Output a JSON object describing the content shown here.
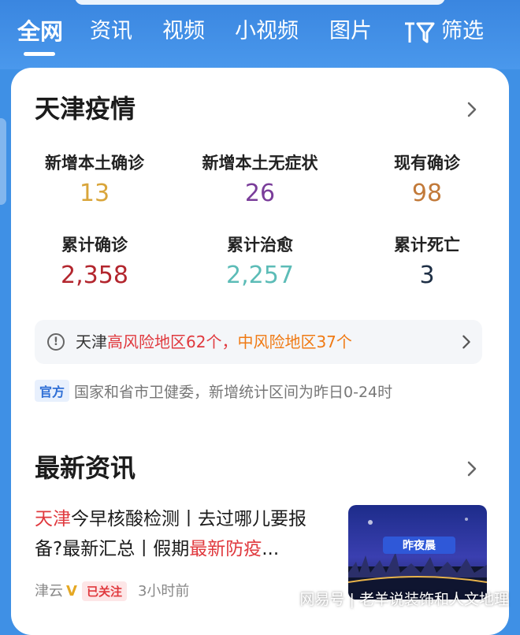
{
  "tabs": [
    "全网",
    "资讯",
    "视频",
    "小视频",
    "图片"
  ],
  "filter_label": "筛选",
  "epidemic": {
    "title": "天津疫情",
    "stats": [
      {
        "label": "新增本土确诊",
        "value": "13",
        "color": "#d9a53a"
      },
      {
        "label": "新增本土无症状",
        "value": "26",
        "color": "#7a3d9a"
      },
      {
        "label": "现有确诊",
        "value": "98",
        "color": "#c27a3a"
      },
      {
        "label": "累计确诊",
        "value": "2,358",
        "color": "#b3262e"
      },
      {
        "label": "累计治愈",
        "value": "2,257",
        "color": "#5cbcb7"
      },
      {
        "label": "累计死亡",
        "value": "3",
        "color": "#1e2f45"
      }
    ],
    "risk": {
      "city": "天津",
      "high": "高风险地区62个",
      "separator": "，",
      "mid": "中风险地区37个"
    },
    "source_badge": "官方",
    "source_text": "国家和省市卫健委，新增统计区间为昨日0-24时"
  },
  "news": {
    "title": "最新资讯",
    "item": {
      "title_hl1": "天津",
      "title_part1": "今早核酸检测丨去过哪儿要报备?最新汇总丨假期",
      "title_hl2": "最新防疫",
      "title_ellipsis": "...",
      "source": "津云",
      "verified": "V",
      "followed": "已关注",
      "time": "3小时前",
      "thumb_text": "昨夜晨"
    }
  },
  "watermark": "网易号 | 老羊说装饰和人文地理"
}
